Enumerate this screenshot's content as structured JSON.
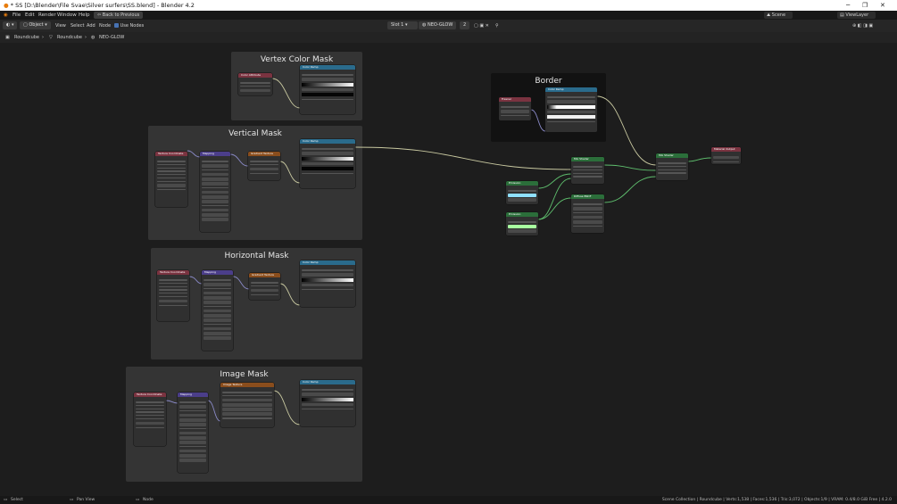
{
  "window": {
    "title": "* SS [D:\\Blender\\File Svae\\Silver surfers\\SS.blend] - Blender 4.2",
    "min": "─",
    "max": "❐",
    "close": "✕"
  },
  "menu": {
    "items": [
      "File",
      "Edit",
      "Render",
      "Window",
      "Help"
    ],
    "back_button": "Back to Previous",
    "scene": "Scene",
    "view_layer": "ViewLayer"
  },
  "header": {
    "mode": "Object",
    "items": [
      "View",
      "Select",
      "Add",
      "Node"
    ],
    "use_nodes": "Use Nodes",
    "slot": "Slot 1",
    "material": "NEO-GLOW",
    "user_count": "2"
  },
  "breadcrumb": {
    "object": "Roundcube",
    "mesh": "Roundcube",
    "material": "NEO-GLOW"
  },
  "frames": {
    "vertex_color": "Vertex Color Mask",
    "vertical": "Vertical Mask",
    "horizontal": "Horizontal Mask",
    "image": "Image Mask",
    "border": "Border"
  },
  "nodes": {
    "color_attribute": "Color Attribute",
    "color_ramp": "Color Ramp",
    "texture_coordinate": "Texture Coordinate",
    "mapping": "Mapping",
    "gradient_texture": "Gradient Texture",
    "image_texture": "Image Texture",
    "fresnel": "Fresnel",
    "mix_shader": "Mix Shader",
    "emission": "Emission",
    "diffuse": "Diffuse BSDF",
    "material_output": "Material Output"
  },
  "status": {
    "select": "Select",
    "pan": "Pan View",
    "node": "Node",
    "stats": "Scene Collection | Roundcube | Verts:1,538 | Faces:1,536 | Tris:3,072 | Objects:1/9 | VRAM: 0.4/8.0 GiB Free | 4.2.0"
  },
  "colors": {
    "accent": "#4772b3",
    "canvas": "#1d1d1d",
    "frame": "#343434",
    "wire": "#c8c8a0",
    "wire_shader": "#5fbf6e"
  }
}
